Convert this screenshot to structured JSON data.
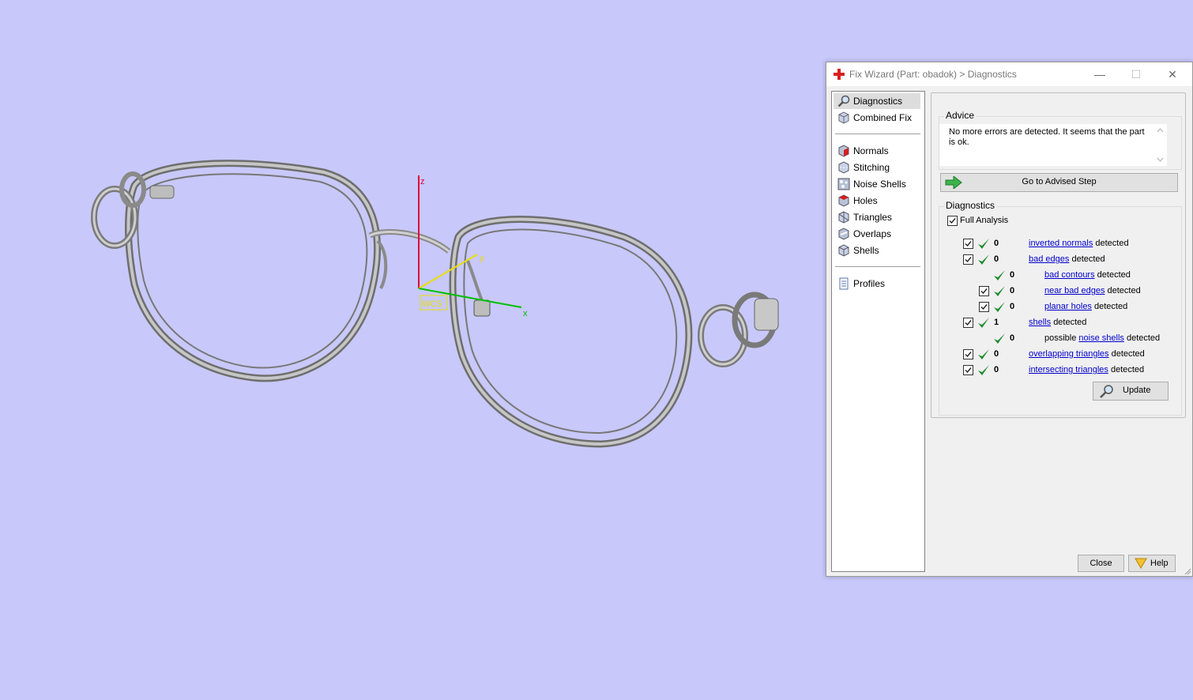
{
  "dialog": {
    "title": "Fix Wizard (Part: obadok) > Diagnostics",
    "min_glyph": "—",
    "max_glyph": "☐",
    "close_glyph": "✕"
  },
  "viewport": {
    "axis_labels": {
      "z": "z",
      "y": "y",
      "x": "x",
      "wcs": "WCS"
    },
    "axis_colors": {
      "z": "#e0003c",
      "y": "#e8e000",
      "x": "#00c000"
    },
    "background": "#c8c8fa"
  },
  "nav": {
    "items": [
      {
        "label": "Diagnostics",
        "icon": "magnifier-icon"
      },
      {
        "label": "Combined Fix",
        "icon": "cube-icon"
      },
      {
        "label": "Normals",
        "icon": "normals-icon"
      },
      {
        "label": "Stitching",
        "icon": "stitching-icon"
      },
      {
        "label": "Noise Shells",
        "icon": "noise-shells-icon"
      },
      {
        "label": "Holes",
        "icon": "holes-icon"
      },
      {
        "label": "Triangles",
        "icon": "triangles-icon"
      },
      {
        "label": "Overlaps",
        "icon": "overlaps-icon"
      },
      {
        "label": "Shells",
        "icon": "shells-icon"
      },
      {
        "label": "Profiles",
        "icon": "document-icon"
      }
    ]
  },
  "advice": {
    "title": "Advice",
    "text": "No more errors are detected. It seems that the part is ok.",
    "advised_step_label": "Go to Advised Step"
  },
  "diagnostics": {
    "title": "Diagnostics",
    "full_analysis_label": "Full Analysis",
    "detected_word": "detected",
    "rows": [
      {
        "checkbox": true,
        "count": "0",
        "link": "inverted normals",
        "prefix": ""
      },
      {
        "checkbox": true,
        "count": "0",
        "link": "bad edges",
        "prefix": ""
      },
      {
        "checkbox": false,
        "count": "0",
        "link": "bad contours",
        "prefix": ""
      },
      {
        "checkbox": true,
        "count": "0",
        "link": "near bad edges",
        "prefix": ""
      },
      {
        "checkbox": true,
        "count": "0",
        "link": "planar holes",
        "prefix": ""
      },
      {
        "checkbox": true,
        "count": "1",
        "link": "shells",
        "prefix": ""
      },
      {
        "checkbox": false,
        "count": "0",
        "link": "noise shells",
        "prefix": "possible"
      },
      {
        "checkbox": true,
        "count": "0",
        "link": "overlapping triangles",
        "prefix": ""
      },
      {
        "checkbox": true,
        "count": "0",
        "link": "intersecting triangles",
        "prefix": ""
      }
    ],
    "update_label": "Update"
  },
  "buttons": {
    "close_label": "Close",
    "help_label": "Help"
  },
  "colors": {
    "check_green": "#1f8a2e",
    "link_blue": "#0000cc",
    "advise_arrow": "#3db24b",
    "help_icon": "#f2c230"
  }
}
